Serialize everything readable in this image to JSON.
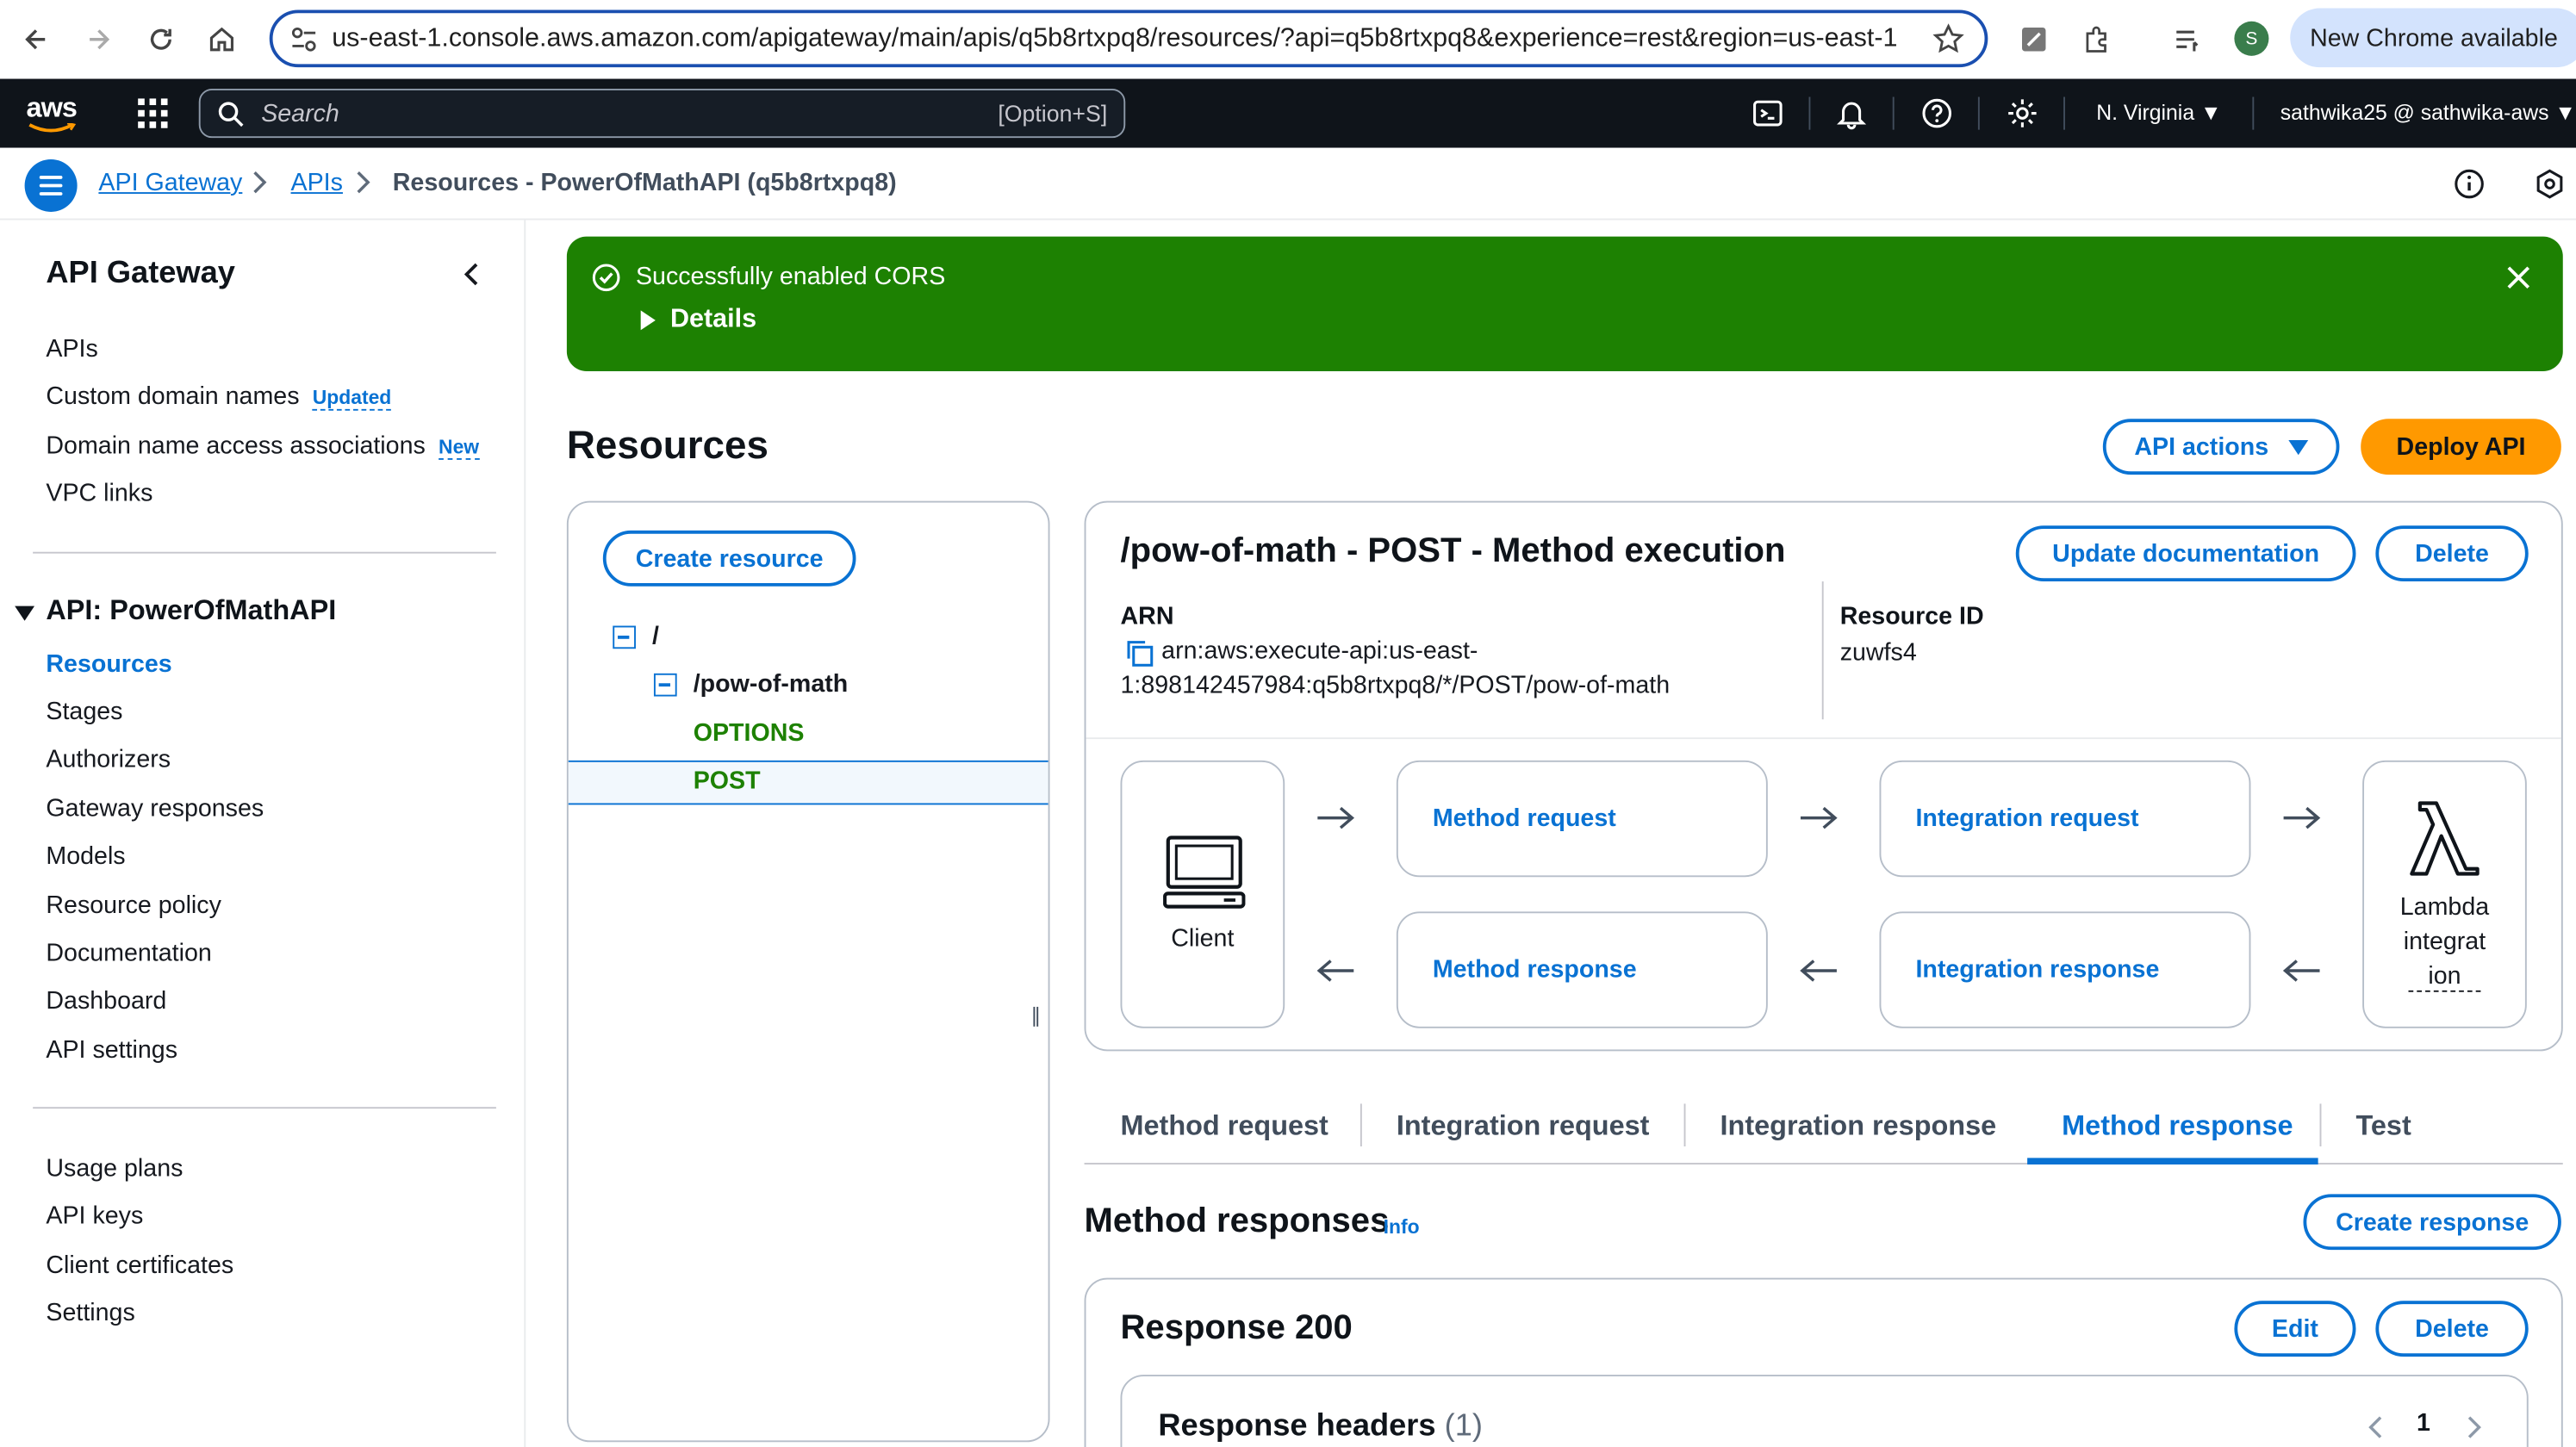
{
  "browser": {
    "url": "us-east-1.console.aws.amazon.com/apigateway/main/apis/q5b8rtxpq8/resources/?api=q5b8rtxpq8&experience=rest&region=us-east-1",
    "profile_initial": "S",
    "new_chrome_label": "New Chrome available"
  },
  "topnav": {
    "logo": "aws",
    "search_placeholder": "Search",
    "search_shortcut": "[Option+S]",
    "region": "N. Virginia",
    "account": "sathwika25 @ sathwika-aws"
  },
  "breadcrumb": {
    "items": [
      "API Gateway",
      "APIs"
    ],
    "current": "Resources - PowerOfMathAPI (q5b8rtxpq8)"
  },
  "sidebar": {
    "title": "API Gateway",
    "top_items": [
      {
        "label": "APIs",
        "badge": ""
      },
      {
        "label": "Custom domain names",
        "badge": "Updated"
      },
      {
        "label": "Domain name access associations",
        "badge": "New"
      },
      {
        "label": "VPC links",
        "badge": ""
      }
    ],
    "api_section": "API: PowerOfMathAPI",
    "api_items": [
      "Resources",
      "Stages",
      "Authorizers",
      "Gateway responses",
      "Models",
      "Resource policy",
      "Documentation",
      "Dashboard",
      "API settings"
    ],
    "active_item": "Resources",
    "bottom_items": [
      "Usage plans",
      "API keys",
      "Client certificates",
      "Settings"
    ]
  },
  "flash": {
    "message": "Successfully enabled CORS",
    "details": "Details",
    "color": "#1d8102"
  },
  "resources": {
    "heading": "Resources",
    "api_actions": "API actions",
    "deploy_api": "Deploy API",
    "create_resource": "Create resource",
    "tree": {
      "root": "/",
      "child": "/pow-of-math",
      "methods": [
        "OPTIONS",
        "POST"
      ],
      "selected": "POST"
    }
  },
  "method_execution": {
    "title": "/pow-of-math - POST - Method execution",
    "update_doc": "Update documentation",
    "delete": "Delete",
    "arn_label": "ARN",
    "arn_line1": "arn:aws:execute-api:us-east-",
    "arn_line2": "1:898142457984:q5b8rtxpq8/*/POST/pow-of-math",
    "resource_id_label": "Resource ID",
    "resource_id": "zuwfs4",
    "client": "Client",
    "method_request": "Method request",
    "integration_request": "Integration request",
    "method_response": "Method response",
    "integration_response": "Integration response",
    "lambda_line1": "Lambda",
    "lambda_line2": "integrat",
    "lambda_line3": "ion"
  },
  "tabs": {
    "items": [
      "Method request",
      "Integration request",
      "Integration response",
      "Method response",
      "Test"
    ],
    "active": "Method response"
  },
  "method_responses": {
    "heading": "Method responses",
    "info": "Info",
    "create_response": "Create response",
    "response_title": "Response 200",
    "edit": "Edit",
    "delete": "Delete",
    "headers_title": "Response headers",
    "headers_count": "(1)",
    "page": "1"
  },
  "colors": {
    "accent": "#0972d3",
    "deploy": "#ff9900",
    "navbar": "#0f141a",
    "method_green": "#1d8102"
  }
}
